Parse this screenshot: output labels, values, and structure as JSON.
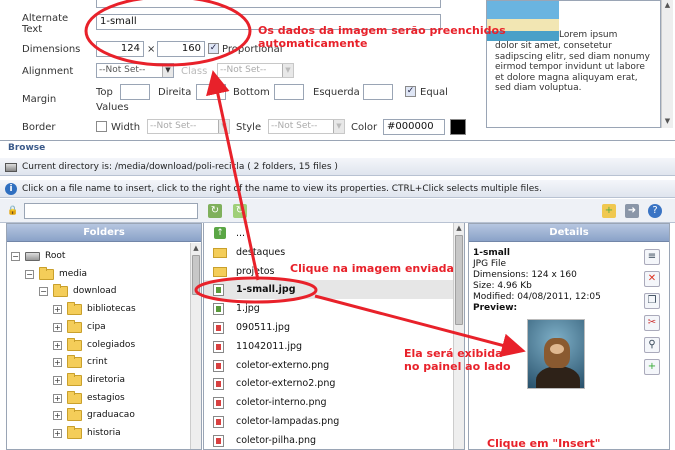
{
  "properties": {
    "alternate_text_label": "Alternate Text",
    "alternate_text_value": "1-small",
    "dimensions_label": "Dimensions",
    "width_value": "124",
    "times_sign": "×",
    "height_value": "160",
    "proportional_label": "Proportional",
    "proportional_checked": true,
    "alignment_label": "Alignment",
    "alignment_value": "--Not Set--",
    "class_label": "Class",
    "class_value": "--Not Set--",
    "margin_label": "Margin",
    "margin_top": "Top",
    "margin_right": "Direita",
    "margin_bottom": "Bottom",
    "margin_left": "Esquerda",
    "equal_values_label_1": "Equal",
    "equal_values_label_2": "Values",
    "equal_values_checked": true,
    "border_label": "Border",
    "border_width_label": "Width",
    "border_width_value": "--Not Set--",
    "border_style_label": "Style",
    "border_style_value": "--Not Set--",
    "border_color_label": "Color",
    "border_color_value": "#000000",
    "preview_first_line": "Lorem ipsum",
    "preview_text": "dolor sit amet, consetetur sadipscing elitr, sed diam nonumy eirmod tempor invidunt ut labore et dolore magna aliquyam erat, sed diam voluptua."
  },
  "browse": {
    "legend": "Browse",
    "current_directory": "Current directory is: /media/download/poli-recicla ( 2 folders, 15 files )",
    "info": "Click on a file name to insert, click to the right of the name to view its properties. CTRL+Click selects multiple files."
  },
  "folders": {
    "header": "Folders",
    "items": [
      {
        "label": "Root",
        "expander": "−"
      },
      {
        "label": "media",
        "expander": "−"
      },
      {
        "label": "download",
        "expander": "−"
      },
      {
        "label": "bibliotecas",
        "expander": "+"
      },
      {
        "label": "cipa",
        "expander": "+"
      },
      {
        "label": "colegiados",
        "expander": "+"
      },
      {
        "label": "crint",
        "expander": "+"
      },
      {
        "label": "diretoria",
        "expander": "+"
      },
      {
        "label": "estagios",
        "expander": "+"
      },
      {
        "label": "graduacao",
        "expander": "+"
      },
      {
        "label": "historia",
        "expander": "+"
      }
    ]
  },
  "files": {
    "items": [
      {
        "label": "...",
        "kind": "up"
      },
      {
        "label": "destaques",
        "kind": "folder"
      },
      {
        "label": "projetos",
        "kind": "folder"
      },
      {
        "label": "1-small.jpg",
        "kind": "jpg",
        "selected": true
      },
      {
        "label": "1.jpg",
        "kind": "jpg"
      },
      {
        "label": "090511.jpg",
        "kind": "file"
      },
      {
        "label": "11042011.jpg",
        "kind": "file"
      },
      {
        "label": "coletor-externo.png",
        "kind": "file"
      },
      {
        "label": "coletor-externo2.png",
        "kind": "file"
      },
      {
        "label": "coletor-interno.png",
        "kind": "file"
      },
      {
        "label": "coletor-lampadas.png",
        "kind": "file"
      },
      {
        "label": "coletor-pilha.png",
        "kind": "file"
      }
    ]
  },
  "details": {
    "header": "Details",
    "name": "1-small",
    "type": "JPG File",
    "dimensions": "Dimensions: 124 x 160",
    "size": "Size: 4.96 Kb",
    "modified": "Modified: 04/08/2011, 12:05",
    "preview": "Preview:"
  },
  "annotations": {
    "auto_fill_1": "Os dados da imagem serão preenchidos",
    "auto_fill_2": "automaticamente",
    "click_image": "Clique na imagem enviada",
    "shown_1": "Ela será exibida",
    "shown_2": "no painel ao lado",
    "click_insert": "Clique em \"Insert\"",
    "annotation_color": "#e8212a"
  }
}
